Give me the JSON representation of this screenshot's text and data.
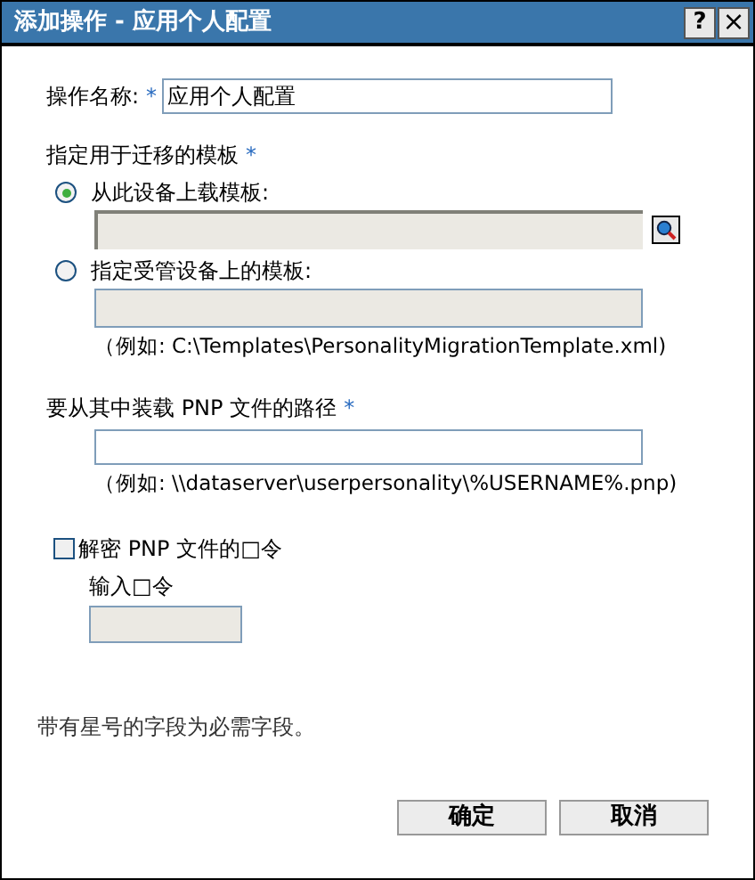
{
  "window": {
    "title": "添加操作 - 应用个人配置",
    "help": "?",
    "close": "×"
  },
  "action_name": {
    "label": "操作名称:",
    "required": "*",
    "value": "应用个人配置"
  },
  "template": {
    "label": "指定用于迁移的模板",
    "required": "*",
    "options": [
      {
        "label": "从此设备上载模板:",
        "selected": true,
        "kind": "browse"
      },
      {
        "label": "指定受管设备上的模板:",
        "selected": false,
        "kind": "hint",
        "hint": "（例如: C:\\Templates\\PersonalityMigrationTemplate.xml)"
      }
    ]
  },
  "pnp_path": {
    "label": "要从其中装载 PNP 文件的路径",
    "required": "*",
    "hint": "（例如: \\\\dataserver\\userpersonality\\%USERNAME%.pnp)"
  },
  "decrypt": {
    "label": "解密 PNP 文件的□令",
    "checked": false,
    "password_label": "输入□令"
  },
  "required_note": "带有星号的字段为必需字段。",
  "buttons": [
    "确定",
    "取消"
  ]
}
